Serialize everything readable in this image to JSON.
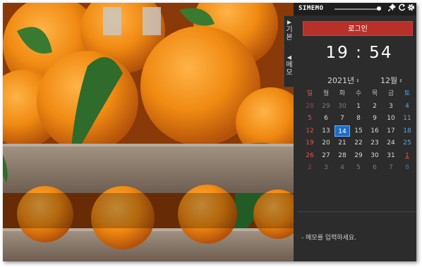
{
  "app": {
    "brand": "SIMEMO"
  },
  "toolbar": {
    "opacity_level": 0.95,
    "pin_icon": "pin-icon",
    "refresh_icon": "refresh-icon",
    "settings_icon": "gear-icon"
  },
  "side_tabs": [
    {
      "arrow": "▶",
      "label": "기본"
    },
    {
      "arrow": "◀",
      "label": "메모"
    }
  ],
  "login": {
    "label": "로그인"
  },
  "clock": {
    "time": "19 : 54"
  },
  "calendar": {
    "year_label": "2021년",
    "month_label": "12월",
    "weekdays": [
      "일",
      "월",
      "화",
      "수",
      "목",
      "금",
      "토"
    ],
    "weeks": [
      [
        "28",
        "29",
        "30",
        "1",
        "2",
        "3",
        "4"
      ],
      [
        "5",
        "6",
        "7",
        "8",
        "9",
        "10",
        "11"
      ],
      [
        "12",
        "13",
        "14",
        "15",
        "16",
        "17",
        "18"
      ],
      [
        "19",
        "20",
        "21",
        "22",
        "23",
        "24",
        "25"
      ],
      [
        "26",
        "27",
        "28",
        "29",
        "30",
        "31",
        "1"
      ],
      [
        "2",
        "3",
        "4",
        "5",
        "6",
        "7",
        "8"
      ]
    ],
    "today": "14"
  },
  "memo": {
    "placeholder": "- 메모를 입력하세요."
  },
  "colors": {
    "panel_bg": "#2c2c2c",
    "login_red": "#b8302a",
    "today_blue": "#1e6ec8",
    "sunday_red": "#e0574d",
    "saturday_blue": "#5aa6ea"
  }
}
